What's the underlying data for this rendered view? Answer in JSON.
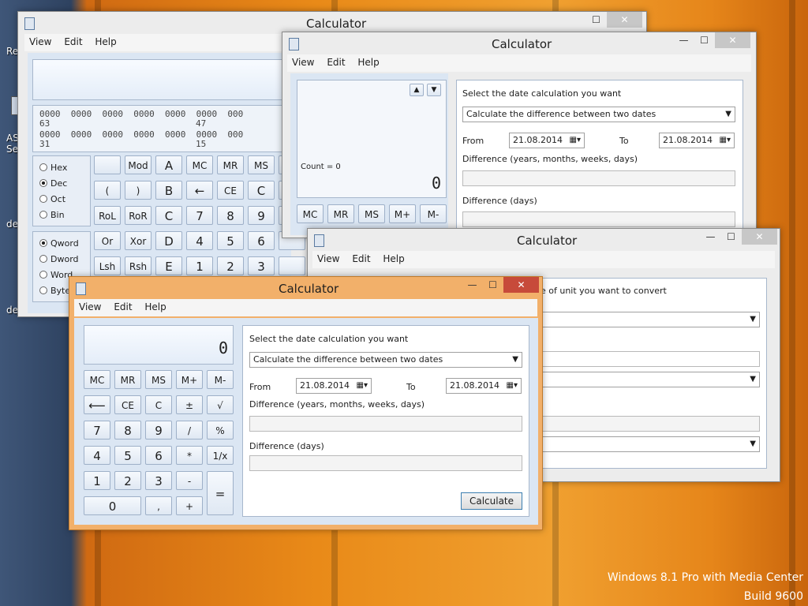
{
  "desktop": {
    "watermark_line1": "Windows 8.1 Pro with Media Center",
    "watermark_line2": "Build 9600",
    "icon_labels": [
      "Re",
      "AS",
      "Se",
      "de",
      "de"
    ]
  },
  "programmer_window": {
    "title": "Calculator",
    "menu": [
      "View",
      "Edit",
      "Help"
    ],
    "bits_rows": [
      {
        "groups": "0000  0000  0000  0000  0000  0000  000",
        "marks_left": "63",
        "marks_mid": "47"
      },
      {
        "groups": "0000  0000  0000  0000  0000  0000  000",
        "marks_left": "31",
        "marks_mid": "15"
      }
    ],
    "base_options": [
      {
        "label": "Hex",
        "selected": false
      },
      {
        "label": "Dec",
        "selected": true
      },
      {
        "label": "Oct",
        "selected": false
      },
      {
        "label": "Bin",
        "selected": false
      }
    ],
    "word_options": [
      {
        "label": "Qword",
        "selected": true
      },
      {
        "label": "Dword",
        "selected": false
      },
      {
        "label": "Word",
        "selected": false
      },
      {
        "label": "Byte",
        "selected": false
      }
    ],
    "buttons": [
      [
        "",
        "Mod",
        "A",
        "MC",
        "MR",
        "MS",
        ""
      ],
      [
        "(",
        ")",
        "B",
        "←",
        "CE",
        "C",
        ""
      ],
      [
        "RoL",
        "RoR",
        "C",
        "7",
        "8",
        "9",
        ""
      ],
      [
        "Or",
        "Xor",
        "D",
        "4",
        "5",
        "6",
        ""
      ],
      [
        "Lsh",
        "Rsh",
        "E",
        "1",
        "2",
        "3",
        ""
      ]
    ]
  },
  "stats_window": {
    "title": "Calculator",
    "menu": [
      "View",
      "Edit",
      "Help"
    ],
    "count_label": "Count = 0",
    "display_value": "0",
    "memory_buttons": [
      "MC",
      "MR",
      "MS",
      "M+",
      "M-"
    ],
    "date_panel": {
      "prompt": "Select the date calculation you want",
      "mode": "Calculate the difference between two dates",
      "from_label": "From",
      "from_value": "21.08.2014",
      "to_label": "To",
      "to_value": "21.08.2014",
      "diff_ymwd_label": "Difference (years, months, weeks, days)",
      "diff_days_label": "Difference (days)"
    }
  },
  "converter_window": {
    "title": "Calculator",
    "menu": [
      "View",
      "Edit",
      "Help"
    ],
    "prompt_fragment": "e of unit you want to convert"
  },
  "main_window": {
    "title": "Calculator",
    "menu": [
      "View",
      "Edit",
      "Help"
    ],
    "display_value": "0",
    "buttons": [
      [
        "MC",
        "MR",
        "MS",
        "M+",
        "M-"
      ],
      [
        "⟵",
        "CE",
        "C",
        "±",
        "√"
      ],
      [
        "7",
        "8",
        "9",
        "/",
        "%"
      ],
      [
        "4",
        "5",
        "6",
        "*",
        "1/x"
      ],
      [
        "1",
        "2",
        "3",
        "-",
        "="
      ],
      [
        "0",
        ",",
        "+"
      ]
    ],
    "date_panel": {
      "prompt": "Select the date calculation you want",
      "mode": "Calculate the difference between two dates",
      "from_label": "From",
      "from_value": "21.08.2014",
      "to_label": "To",
      "to_value": "21.08.2014",
      "diff_ymwd_label": "Difference (years, months, weeks, days)",
      "diff_days_label": "Difference (days)",
      "calculate_label": "Calculate"
    }
  }
}
